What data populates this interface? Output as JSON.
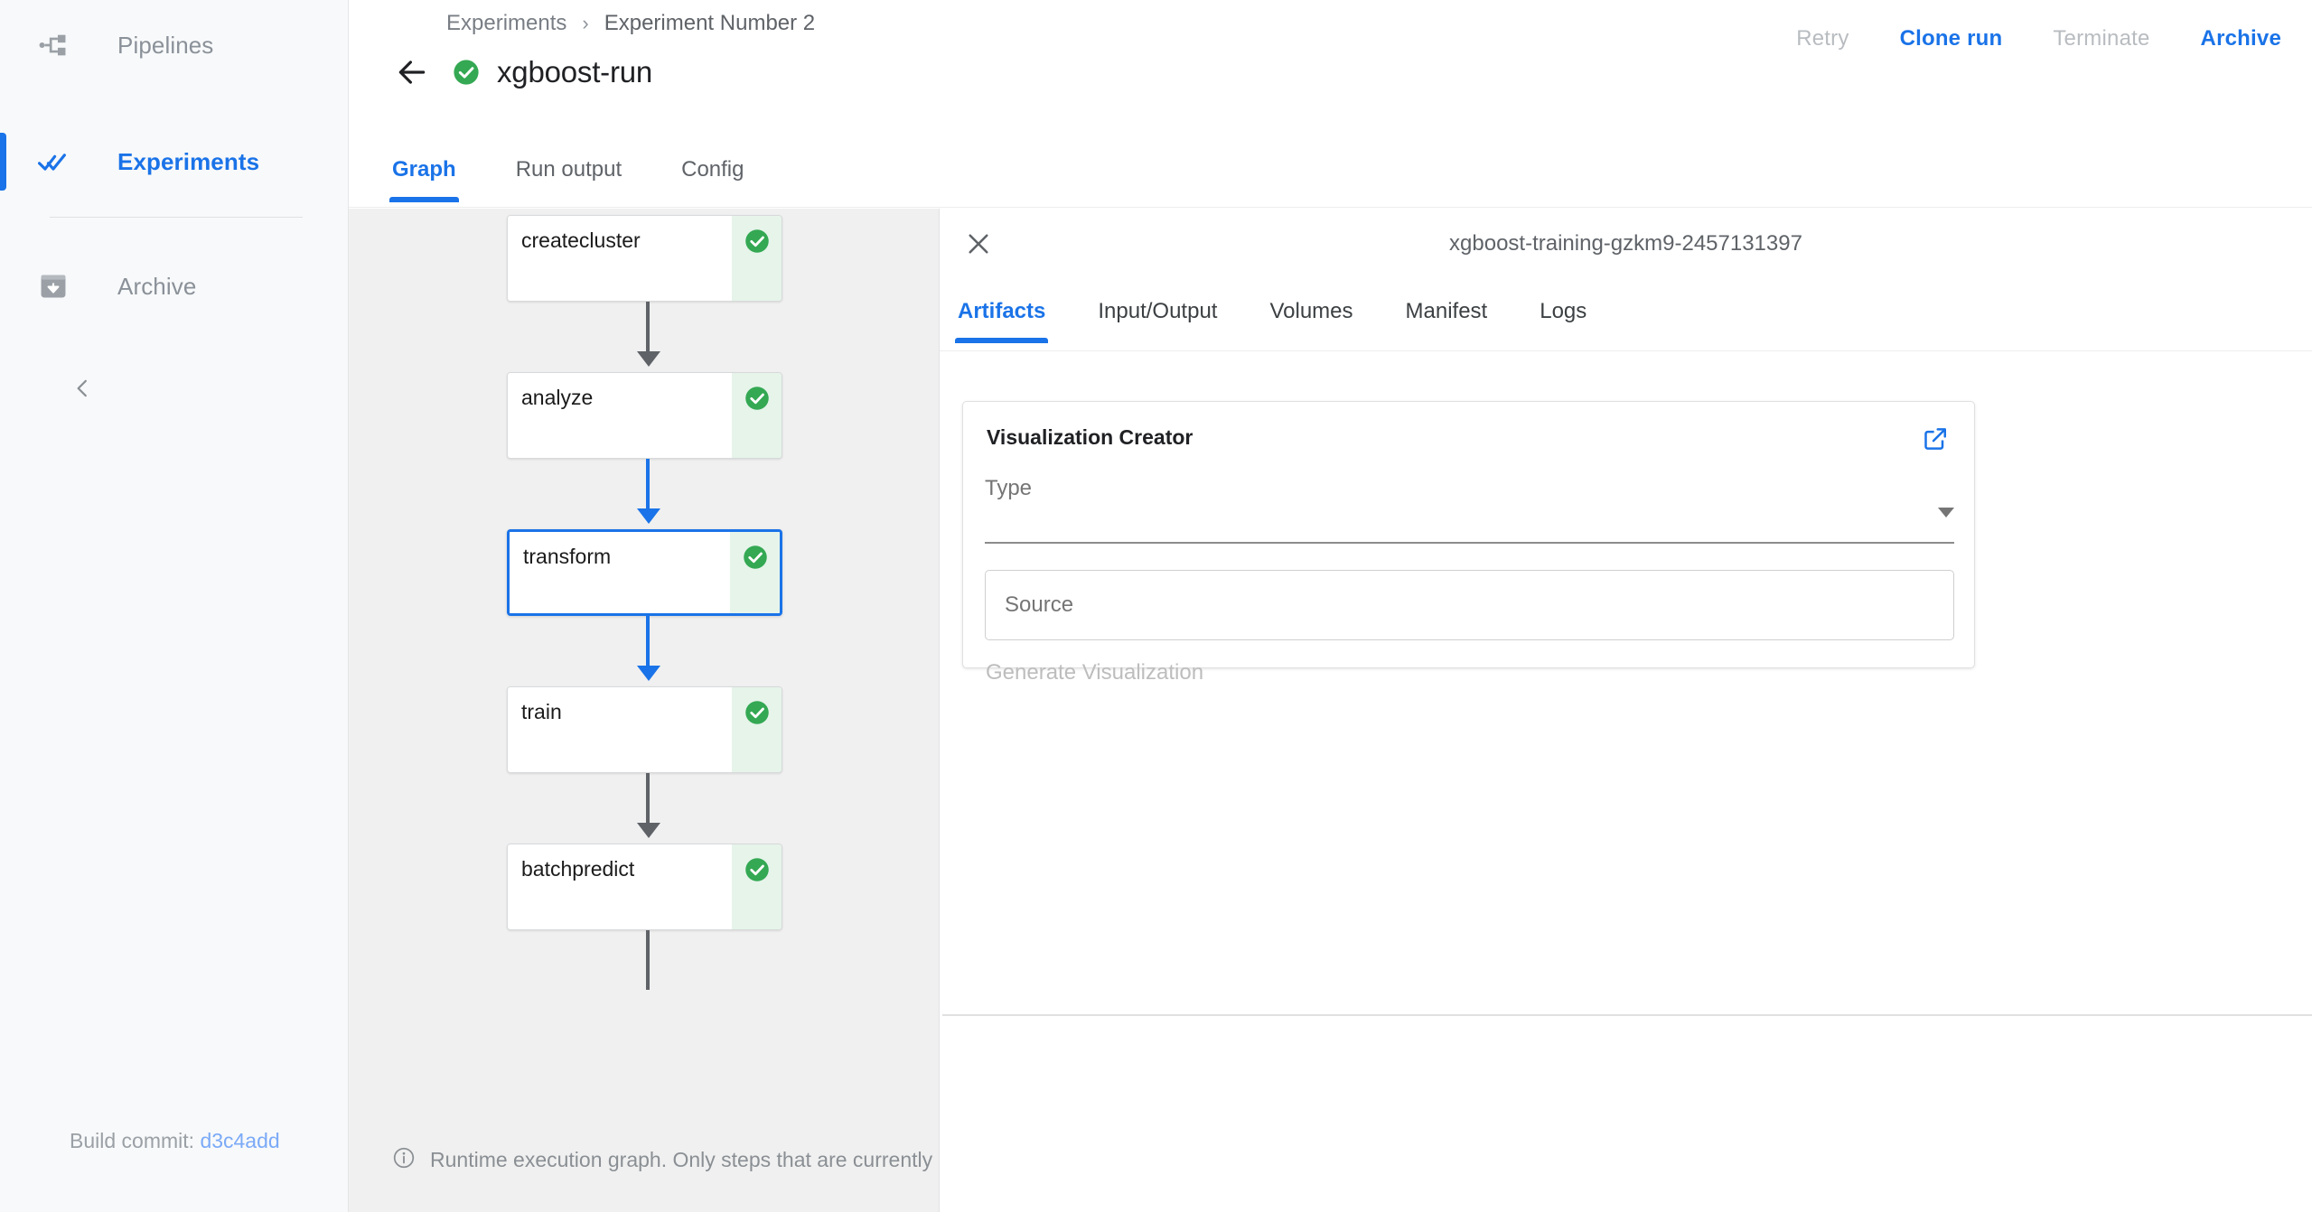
{
  "sidebar": {
    "items": [
      {
        "label": "Pipelines",
        "icon": "pipelines-icon",
        "active": false
      },
      {
        "label": "Experiments",
        "icon": "double-check-icon",
        "active": true
      },
      {
        "label": "Archive",
        "icon": "archive-box-icon",
        "active": false
      }
    ],
    "collapse_icon": "chevron-left-icon",
    "build_commit_label": "Build commit:",
    "build_commit_value": "d3c4add"
  },
  "header": {
    "breadcrumb": {
      "root": "Experiments",
      "separator": "›",
      "current": "Experiment Number 2"
    },
    "back_icon": "arrow-left-icon",
    "status_icon": "check-circle-icon",
    "title": "xgboost-run",
    "actions": [
      {
        "label": "Retry",
        "state": "disabled"
      },
      {
        "label": "Clone run",
        "state": "enabled"
      },
      {
        "label": "Terminate",
        "state": "disabled"
      },
      {
        "label": "Archive",
        "state": "enabled"
      }
    ]
  },
  "main_tabs": [
    {
      "label": "Graph",
      "active": true
    },
    {
      "label": "Run output",
      "active": false
    },
    {
      "label": "Config",
      "active": false
    }
  ],
  "graph": {
    "nodes": [
      {
        "label": "createcluster",
        "status": "succeeded",
        "selected": false
      },
      {
        "label": "analyze",
        "status": "succeeded",
        "selected": false
      },
      {
        "label": "transform",
        "status": "succeeded",
        "selected": true
      },
      {
        "label": "train",
        "status": "succeeded",
        "selected": false
      },
      {
        "label": "batchpredict",
        "status": "succeeded",
        "selected": false
      }
    ],
    "footer_icon": "info-icon",
    "footer_text": "Runtime execution graph. Only steps that are currently runni"
  },
  "side_panel": {
    "close_icon": "close-icon",
    "title": "xgboost-training-gzkm9-2457131397",
    "tabs": [
      {
        "label": "Artifacts",
        "active": true
      },
      {
        "label": "Input/Output",
        "active": false
      },
      {
        "label": "Volumes",
        "active": false
      },
      {
        "label": "Manifest",
        "active": false
      },
      {
        "label": "Logs",
        "active": false
      }
    ],
    "visualization_creator": {
      "title": "Visualization Creator",
      "open_icon": "open-in-new-icon",
      "type_label": "Type",
      "type_value": "",
      "dropdown_icon": "chevron-down-icon",
      "source_label": "Source",
      "source_value": "",
      "generate_label": "Generate Visualization",
      "generate_state": "disabled"
    }
  },
  "colors": {
    "accent": "#1a73e8",
    "success": "#34a853",
    "success_bg": "#e6f4ea",
    "canvas_bg": "#f0f0f0",
    "sidebar_bg": "#f8f9fa",
    "muted_text": "#9aa0a6"
  }
}
